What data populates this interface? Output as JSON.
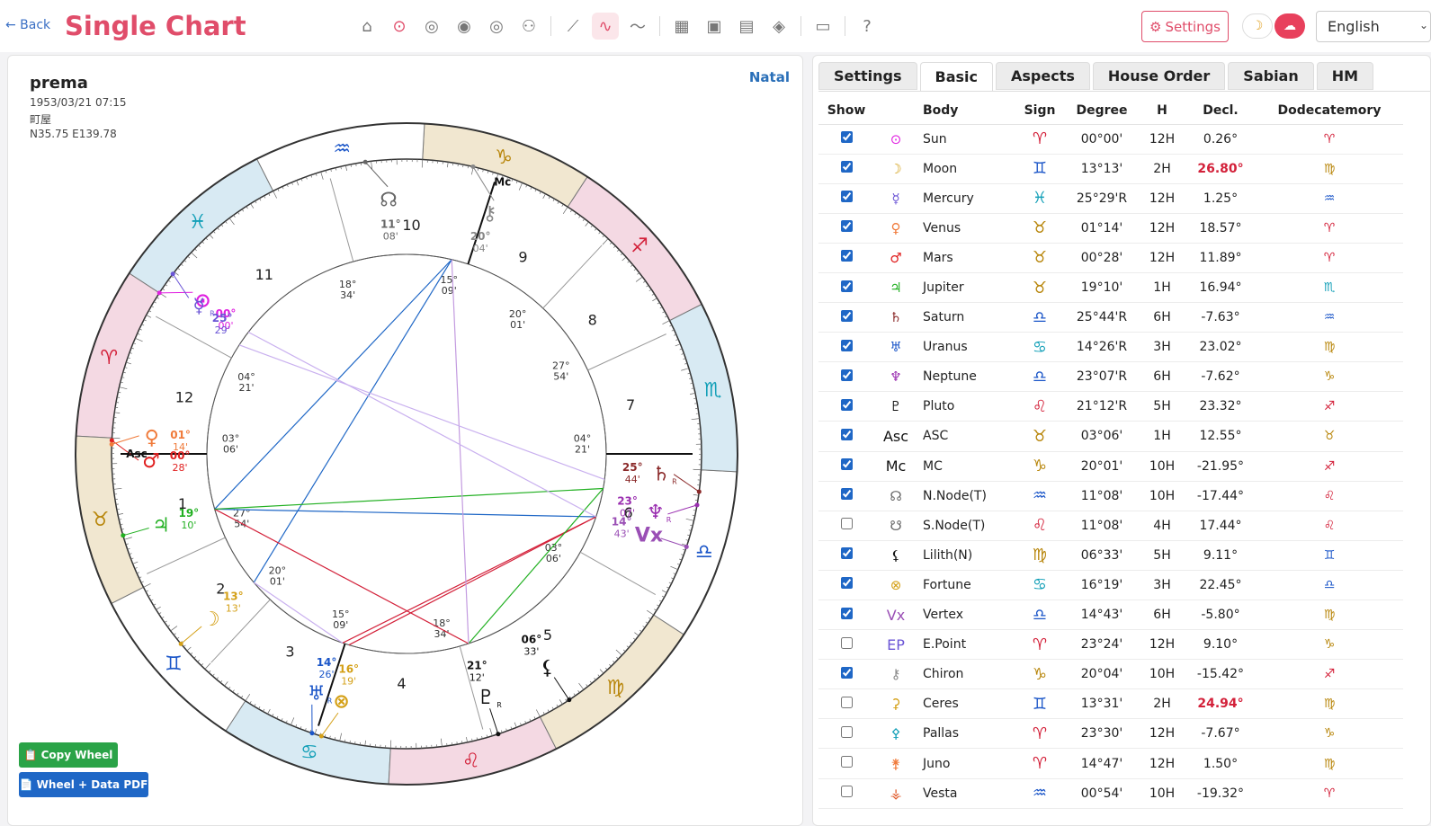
{
  "header": {
    "back_label": "← Back",
    "title": "Single Chart",
    "nav_icons": [
      "home-icon",
      "sun-circle-icon",
      "concentric-circles-icon",
      "double-ring-icon",
      "target-icon",
      "robot-icon",
      "line-chart-icon",
      "wave-icon",
      "sine-icon",
      "map-icon",
      "calendar-icon",
      "calendar-refresh-icon",
      "compass-icon",
      "clipboard-icon",
      "help-icon"
    ],
    "active_nav": "wave-icon",
    "settings_label": "Settings",
    "language": "English"
  },
  "person": {
    "name": "prema",
    "datetime": "1953/03/21 07:15",
    "place": "町屋",
    "coords": "N35.75 E139.78"
  },
  "chart_type_label": "Natal",
  "buttons": {
    "copy_wheel": "Copy Wheel",
    "wheel_pdf": "Wheel + Data PDF"
  },
  "wheel": {
    "house_numbers": [
      "1",
      "2",
      "3",
      "4",
      "5",
      "6",
      "7",
      "8",
      "9",
      "10",
      "11",
      "12"
    ],
    "angle_labels": {
      "asc": "Asc",
      "mc": "Mc"
    },
    "cusps": [
      {
        "house": "1",
        "deg": "03°",
        "min": "06'"
      },
      {
        "house": "2",
        "deg": "27°",
        "min": "54'"
      },
      {
        "house": "3",
        "deg": "20°",
        "min": "01'"
      },
      {
        "house": "4",
        "deg": "15°",
        "min": "09'"
      },
      {
        "house": "5",
        "deg": "18°",
        "min": "34'"
      },
      {
        "house": "6",
        "deg": "03°",
        "min": "06'"
      },
      {
        "house": "7",
        "deg": "04°",
        "min": "21'"
      },
      {
        "house": "8",
        "deg": "27°",
        "min": "54'"
      },
      {
        "house": "9",
        "deg": "20°",
        "min": "01'"
      },
      {
        "house": "10",
        "deg": "15°",
        "min": "09'"
      },
      {
        "house": "11",
        "deg": "18°",
        "min": "34'"
      },
      {
        "house": "12",
        "deg": "04°",
        "min": "21'"
      }
    ],
    "planets": [
      {
        "name": "Sun",
        "glyph": "⊙",
        "deg": "00°",
        "min": "00'",
        "color": "#e01fe0"
      },
      {
        "name": "Mercury",
        "glyph": "☿",
        "deg": "25°",
        "min": "29'",
        "retro": "R",
        "color": "#6b55d6"
      },
      {
        "name": "Mars",
        "glyph": "♂",
        "deg": "00°",
        "min": "28'",
        "color": "#e02020"
      },
      {
        "name": "Venus",
        "glyph": "♀",
        "deg": "01°",
        "min": "14'",
        "color": "#f07a3a"
      },
      {
        "name": "Jupiter",
        "glyph": "♃",
        "deg": "19°",
        "min": "10'",
        "color": "#22b022"
      },
      {
        "name": "Moon",
        "glyph": "☽",
        "deg": "13°",
        "min": "13'",
        "color": "#d4a017"
      },
      {
        "name": "Uranus",
        "glyph": "♅",
        "deg": "14°",
        "min": "26'",
        "retro": "R",
        "color": "#1a55c8"
      },
      {
        "name": "Fortune",
        "glyph": "⊗",
        "deg": "16°",
        "min": "19'",
        "color": "#d4a017"
      },
      {
        "name": "Pluto",
        "glyph": "♇",
        "deg": "21°",
        "min": "12'",
        "retro": "R",
        "color": "#111111"
      },
      {
        "name": "Lilith",
        "glyph": "⚸",
        "deg": "06°",
        "min": "33'",
        "color": "#111111"
      },
      {
        "name": "Vertex",
        "glyph": "Vx",
        "deg": "14°",
        "min": "43'",
        "color": "#9a4fb5"
      },
      {
        "name": "Neptune",
        "glyph": "♆",
        "deg": "23°",
        "min": "07'",
        "retro": "R",
        "color": "#9a2fb0"
      },
      {
        "name": "Saturn",
        "glyph": "♄",
        "deg": "25°",
        "min": "44'",
        "retro": "R",
        "color": "#8b2a2a"
      },
      {
        "name": "MC",
        "glyph": "Mc",
        "deg": "20°",
        "min": "01'",
        "color": "#111111"
      },
      {
        "name": "Chiron",
        "glyph": "⚷",
        "deg": "20°",
        "min": "04'",
        "color": "#888888"
      },
      {
        "name": "N.Node",
        "glyph": "☊",
        "deg": "11°",
        "min": "08'",
        "color": "#666666"
      },
      {
        "name": "ASC",
        "glyph": "Asc",
        "deg": "03°",
        "min": "06'",
        "color": "#111111"
      }
    ]
  },
  "tabs": [
    "Settings",
    "Basic",
    "Aspects",
    "House Order",
    "Sabian",
    "HM"
  ],
  "active_tab": "Basic",
  "table": {
    "headers": [
      "Show",
      "",
      "Body",
      "Sign",
      "Degree",
      "H",
      "Decl.",
      "Dodecatemory"
    ],
    "rows": [
      {
        "show": true,
        "icon": "⊙",
        "icon_color": "#e01fe0",
        "body": "Sun",
        "sign": "♈",
        "sign_color": "#d3213a",
        "degree": "00°00'",
        "h": "12H",
        "decl": "0.26°",
        "decl_red": false,
        "dodec": "♈",
        "dodec_color": "#d3213a"
      },
      {
        "show": true,
        "icon": "☽",
        "icon_color": "#d4a017",
        "body": "Moon",
        "sign": "♊",
        "sign_color": "#1a55c8",
        "degree": "13°13'",
        "h": "2H",
        "decl": "26.80°",
        "decl_red": true,
        "dodec": "♍",
        "dodec_color": "#b8860b"
      },
      {
        "show": true,
        "icon": "☿",
        "icon_color": "#6b55d6",
        "body": "Mercury",
        "sign": "♓",
        "sign_color": "#14a0b8",
        "degree": "25°29'R",
        "h": "12H",
        "decl": "1.25°",
        "decl_red": false,
        "dodec": "♒",
        "dodec_color": "#1a55c8"
      },
      {
        "show": true,
        "icon": "♀",
        "icon_color": "#f07a3a",
        "body": "Venus",
        "sign": "♉",
        "sign_color": "#b8860b",
        "degree": "01°14'",
        "h": "12H",
        "decl": "18.57°",
        "decl_red": false,
        "dodec": "♈",
        "dodec_color": "#d3213a"
      },
      {
        "show": true,
        "icon": "♂",
        "icon_color": "#e02020",
        "body": "Mars",
        "sign": "♉",
        "sign_color": "#b8860b",
        "degree": "00°28'",
        "h": "12H",
        "decl": "11.89°",
        "decl_red": false,
        "dodec": "♈",
        "dodec_color": "#d3213a"
      },
      {
        "show": true,
        "icon": "♃",
        "icon_color": "#22b022",
        "body": "Jupiter",
        "sign": "♉",
        "sign_color": "#b8860b",
        "degree": "19°10'",
        "h": "1H",
        "decl": "16.94°",
        "decl_red": false,
        "dodec": "♏",
        "dodec_color": "#14a0b8"
      },
      {
        "show": true,
        "icon": "♄",
        "icon_color": "#8b2a2a",
        "body": "Saturn",
        "sign": "♎",
        "sign_color": "#1a55c8",
        "degree": "25°44'R",
        "h": "6H",
        "decl": "-7.63°",
        "decl_red": false,
        "dodec": "♒",
        "dodec_color": "#1a55c8"
      },
      {
        "show": true,
        "icon": "♅",
        "icon_color": "#1a55c8",
        "body": "Uranus",
        "sign": "♋",
        "sign_color": "#14a0b8",
        "degree": "14°26'R",
        "h": "3H",
        "decl": "23.02°",
        "decl_red": false,
        "dodec": "♍",
        "dodec_color": "#b8860b"
      },
      {
        "show": true,
        "icon": "♆",
        "icon_color": "#9a2fb0",
        "body": "Neptune",
        "sign": "♎",
        "sign_color": "#1a55c8",
        "degree": "23°07'R",
        "h": "6H",
        "decl": "-7.62°",
        "decl_red": false,
        "dodec": "♑",
        "dodec_color": "#b8860b"
      },
      {
        "show": true,
        "icon": "♇",
        "icon_color": "#111111",
        "body": "Pluto",
        "sign": "♌",
        "sign_color": "#d3213a",
        "degree": "21°12'R",
        "h": "5H",
        "decl": "23.32°",
        "decl_red": false,
        "dodec": "♐",
        "dodec_color": "#d3213a"
      },
      {
        "show": true,
        "icon": "Asc",
        "icon_color": "#111111",
        "body": "ASC",
        "sign": "♉",
        "sign_color": "#b8860b",
        "degree": "03°06'",
        "h": "1H",
        "decl": "12.55°",
        "decl_red": false,
        "dodec": "♉",
        "dodec_color": "#b8860b"
      },
      {
        "show": true,
        "icon": "Mc",
        "icon_color": "#111111",
        "body": "MC",
        "sign": "♑",
        "sign_color": "#b8860b",
        "degree": "20°01'",
        "h": "10H",
        "decl": "-21.95°",
        "decl_red": false,
        "dodec": "♐",
        "dodec_color": "#d3213a"
      },
      {
        "show": true,
        "icon": "☊",
        "icon_color": "#666666",
        "body": "N.Node(T)",
        "sign": "♒",
        "sign_color": "#1a55c8",
        "degree": "11°08'",
        "h": "10H",
        "decl": "-17.44°",
        "decl_red": false,
        "dodec": "♌",
        "dodec_color": "#d3213a"
      },
      {
        "show": false,
        "icon": "☋",
        "icon_color": "#666666",
        "body": "S.Node(T)",
        "sign": "♌",
        "sign_color": "#d3213a",
        "degree": "11°08'",
        "h": "4H",
        "decl": "17.44°",
        "decl_red": false,
        "dodec": "♌",
        "dodec_color": "#d3213a"
      },
      {
        "show": true,
        "icon": "⚸",
        "icon_color": "#111111",
        "body": "Lilith(N)",
        "sign": "♍",
        "sign_color": "#b8860b",
        "degree": "06°33'",
        "h": "5H",
        "decl": "9.11°",
        "decl_red": false,
        "dodec": "♊",
        "dodec_color": "#1a55c8"
      },
      {
        "show": true,
        "icon": "⊗",
        "icon_color": "#d4a017",
        "body": "Fortune",
        "sign": "♋",
        "sign_color": "#14a0b8",
        "degree": "16°19'",
        "h": "3H",
        "decl": "22.45°",
        "decl_red": false,
        "dodec": "♎",
        "dodec_color": "#1a55c8"
      },
      {
        "show": true,
        "icon": "Vx",
        "icon_color": "#9a4fb5",
        "body": "Vertex",
        "sign": "♎",
        "sign_color": "#1a55c8",
        "degree": "14°43'",
        "h": "6H",
        "decl": "-5.80°",
        "decl_red": false,
        "dodec": "♍",
        "dodec_color": "#b8860b"
      },
      {
        "show": false,
        "icon": "EP",
        "icon_color": "#6b55d6",
        "body": "E.Point",
        "sign": "♈",
        "sign_color": "#d3213a",
        "degree": "23°24'",
        "h": "12H",
        "decl": "9.10°",
        "decl_red": false,
        "dodec": "♑",
        "dodec_color": "#b8860b"
      },
      {
        "show": true,
        "icon": "⚷",
        "icon_color": "#888888",
        "body": "Chiron",
        "sign": "♑",
        "sign_color": "#b8860b",
        "degree": "20°04'",
        "h": "10H",
        "decl": "-15.42°",
        "decl_red": false,
        "dodec": "♐",
        "dodec_color": "#d3213a"
      },
      {
        "show": false,
        "icon": "⚳",
        "icon_color": "#d4a017",
        "body": "Ceres",
        "sign": "♊",
        "sign_color": "#1a55c8",
        "degree": "13°31'",
        "h": "2H",
        "decl": "24.94°",
        "decl_red": true,
        "dodec": "♍",
        "dodec_color": "#b8860b"
      },
      {
        "show": false,
        "icon": "⚴",
        "icon_color": "#14a0b8",
        "body": "Pallas",
        "sign": "♈",
        "sign_color": "#d3213a",
        "degree": "23°30'",
        "h": "12H",
        "decl": "-7.67°",
        "decl_red": false,
        "dodec": "♑",
        "dodec_color": "#b8860b"
      },
      {
        "show": false,
        "icon": "⚵",
        "icon_color": "#f07a3a",
        "body": "Juno",
        "sign": "♈",
        "sign_color": "#d3213a",
        "degree": "14°47'",
        "h": "12H",
        "decl": "1.50°",
        "decl_red": false,
        "dodec": "♍",
        "dodec_color": "#b8860b"
      },
      {
        "show": false,
        "icon": "⚶",
        "icon_color": "#e05a2a",
        "body": "Vesta",
        "sign": "♒",
        "sign_color": "#1a55c8",
        "degree": "00°54'",
        "h": "10H",
        "decl": "-19.32°",
        "decl_red": false,
        "dodec": "♈",
        "dodec_color": "#d3213a"
      }
    ]
  }
}
